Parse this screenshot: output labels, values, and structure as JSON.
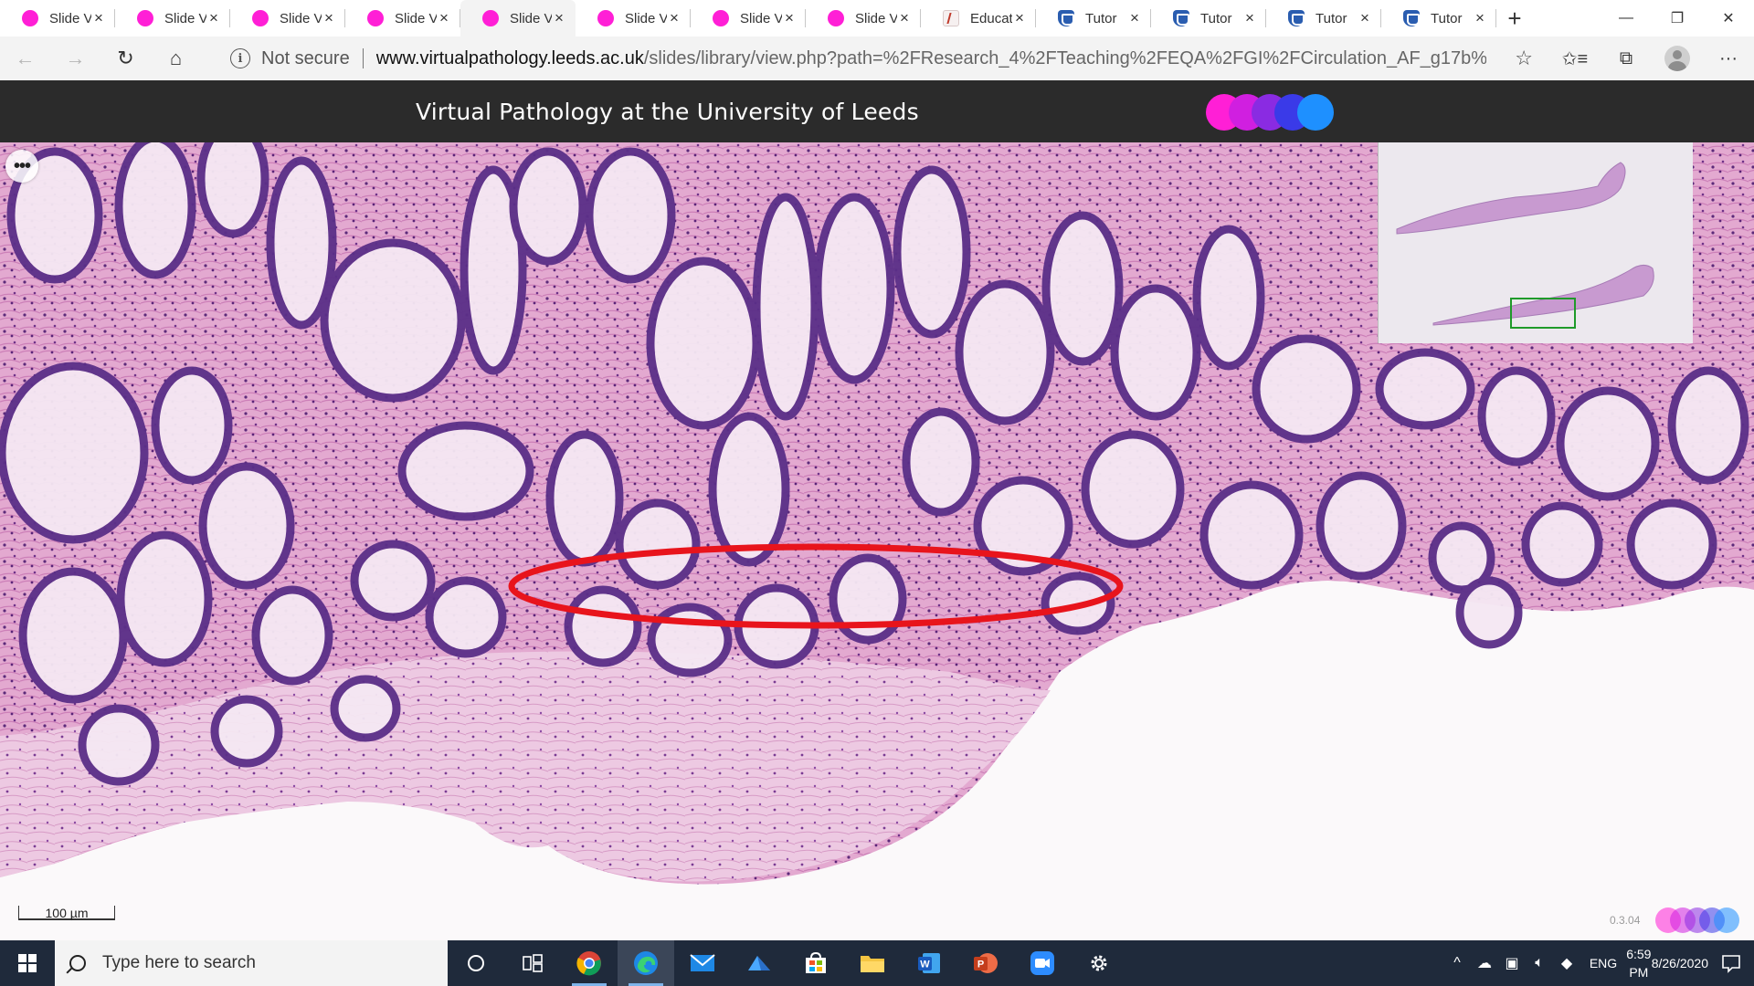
{
  "browser": {
    "tabs": [
      {
        "label": "Slide V",
        "icon": "pink-circle-icon",
        "active": false
      },
      {
        "label": "Slide V",
        "icon": "pink-circle-icon",
        "active": false
      },
      {
        "label": "Slide V",
        "icon": "pink-circle-icon",
        "active": false
      },
      {
        "label": "Slide V",
        "icon": "pink-circle-icon",
        "active": false
      },
      {
        "label": "Slide V",
        "icon": "pink-circle-icon",
        "active": true
      },
      {
        "label": "Slide V",
        "icon": "pink-circle-icon",
        "active": false
      },
      {
        "label": "Slide V",
        "icon": "pink-circle-icon",
        "active": false
      },
      {
        "label": "Slide V",
        "icon": "pink-circle-icon",
        "active": false
      },
      {
        "label": "Educat",
        "icon": "education-icon",
        "active": false
      },
      {
        "label": "Tutor",
        "icon": "shield-icon",
        "active": false
      },
      {
        "label": "Tutor",
        "icon": "shield-icon",
        "active": false
      },
      {
        "label": "Tutor",
        "icon": "shield-icon",
        "active": false
      },
      {
        "label": "Tutor",
        "icon": "shield-icon",
        "active": false
      }
    ],
    "close_glyph": "×",
    "new_tab_glyph": "+",
    "window_controls": {
      "minimize": "—",
      "maximize": "❐",
      "close": "✕"
    },
    "nav": {
      "back": "←",
      "forward": "→",
      "refresh": "↻",
      "home": "⌂"
    },
    "security_label": "Not secure",
    "url_host": "www.virtualpathology.leeds.ac.uk",
    "url_path": "/slides/library/view.php?path=%2FResearch_4%2FTeaching%2FEQA%2FGI%2FCirculation_AF_g17b%2F...",
    "favorite_glyph": "☆",
    "right_icons": {
      "favorites": "✩≡",
      "collections": "⧉",
      "more": "···"
    }
  },
  "site": {
    "title": "Virtual Pathology at the University of Leeds",
    "logo_colors": [
      "#ff1fd6",
      "#d01fe0",
      "#8a2be2",
      "#3a3ae8",
      "#1e90ff"
    ]
  },
  "viewer": {
    "menu_glyph": "•••",
    "scale_bar_label": "100 µm",
    "version": "0.3.04",
    "annotation_color": "#e8141c",
    "overview_viewport_color": "#1f9a2a"
  },
  "taskbar": {
    "search_placeholder": "Type here to search",
    "apps": [
      "cortana-icon",
      "task-view-icon",
      "chrome-icon",
      "edge-icon",
      "mail-icon",
      "azure-data-studio-icon",
      "store-icon",
      "file-explorer-icon",
      "word-icon",
      "powerpoint-icon",
      "zoom-icon",
      "settings-icon"
    ],
    "language": "ENG",
    "time": "6:59 PM",
    "date": "8/26/2020"
  }
}
